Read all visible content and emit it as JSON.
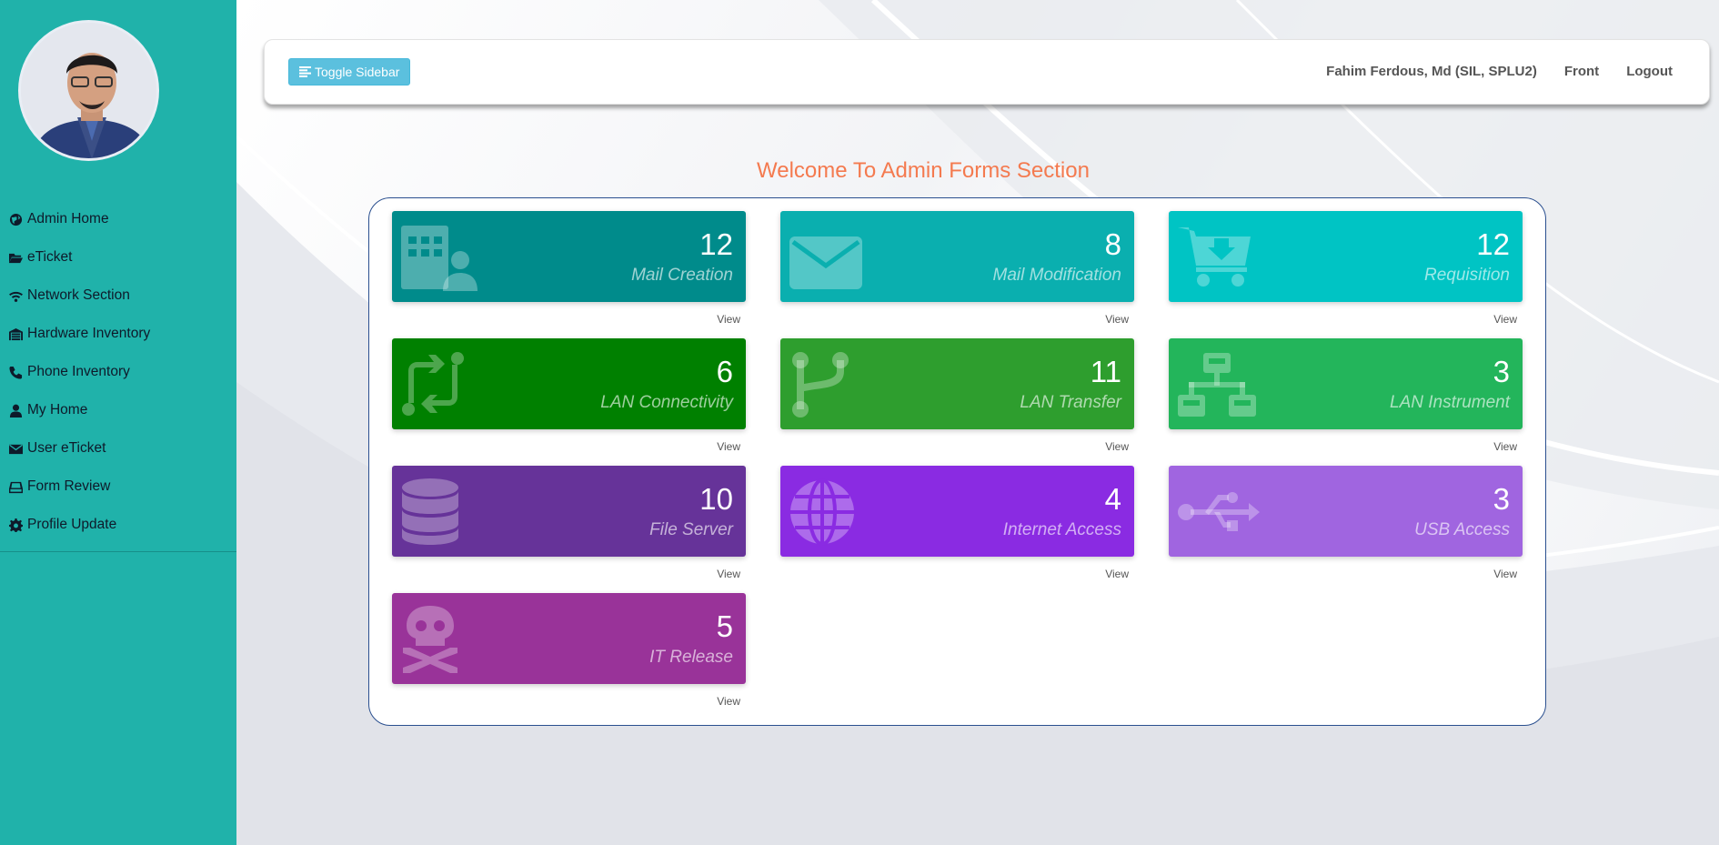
{
  "sidebar": {
    "items": [
      {
        "label": "Admin Home",
        "icon": "globe-icon"
      },
      {
        "label": "eTicket",
        "icon": "folder-open-icon"
      },
      {
        "label": "Network Section",
        "icon": "wifi-icon"
      },
      {
        "label": "Hardware Inventory",
        "icon": "warehouse-icon"
      },
      {
        "label": "Phone Inventory",
        "icon": "phone-icon"
      },
      {
        "label": "My Home",
        "icon": "user-icon"
      },
      {
        "label": "User eTicket",
        "icon": "envelope-icon"
      },
      {
        "label": "Form Review",
        "icon": "hdd-icon"
      },
      {
        "label": "Profile Update",
        "icon": "cog-icon"
      }
    ]
  },
  "header": {
    "toggle_label": "Toggle Sidebar",
    "user_name": "Fahim Ferdous, Md (SIL, SPLU2)",
    "front_label": "Front",
    "logout_label": "Logout"
  },
  "main": {
    "welcome": "Welcome To Admin Forms Section",
    "view_label": "View",
    "cards": [
      {
        "count": "12",
        "label": "Mail Creation",
        "color": "#008b8b",
        "icon": "building-user-icon"
      },
      {
        "count": "8",
        "label": "Mail Modification",
        "color": "#0aafaf",
        "icon": "envelope-icon"
      },
      {
        "count": "12",
        "label": "Requisition",
        "color": "#00c4c4",
        "icon": "cart-icon"
      },
      {
        "count": "6",
        "label": "LAN Connectivity",
        "color": "#008000",
        "icon": "sync-icon"
      },
      {
        "count": "11",
        "label": "LAN Transfer",
        "color": "#2e9e2e",
        "icon": "code-branch-icon"
      },
      {
        "count": "3",
        "label": "LAN Instrument",
        "color": "#23b55b",
        "icon": "network-icon"
      },
      {
        "count": "10",
        "label": "File Server",
        "color": "#663399",
        "icon": "database-icon"
      },
      {
        "count": "4",
        "label": "Internet Access",
        "color": "#8a2be2",
        "icon": "globe-icon"
      },
      {
        "count": "3",
        "label": "USB Access",
        "color": "#a065e0",
        "icon": "usb-icon"
      },
      {
        "count": "5",
        "label": "IT Release",
        "color": "#993399",
        "icon": "skull-icon"
      }
    ]
  }
}
